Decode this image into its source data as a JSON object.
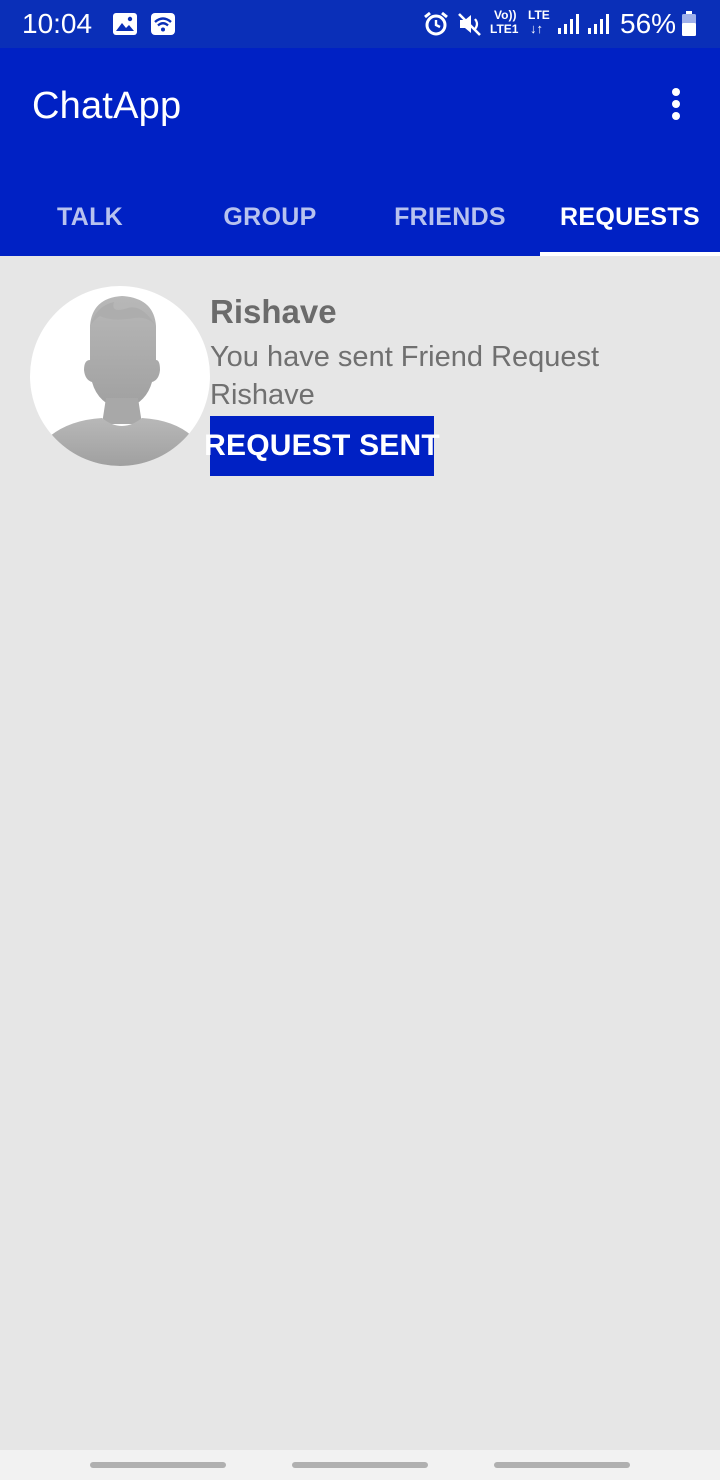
{
  "status_bar": {
    "time": "10:04",
    "battery_percent": "56%",
    "network_lte_top": "Vo))",
    "network_lte_bottom": "LTE1",
    "network_lte2_top": "LTE",
    "network_lte2_bottom": "↓↑",
    "icons": [
      "image-icon",
      "wifi-icon",
      "alarm-icon",
      "mute-icon",
      "signal-icon",
      "signal-icon",
      "battery-icon"
    ]
  },
  "app_bar": {
    "title": "ChatApp",
    "menu_icon": "overflow-menu-icon"
  },
  "tabs": [
    {
      "label": "TALK",
      "active": false
    },
    {
      "label": "GROUP",
      "active": false
    },
    {
      "label": "FRIENDS",
      "active": false
    },
    {
      "label": "REQUESTS",
      "active": true
    }
  ],
  "requests": [
    {
      "name": "Rishave",
      "message": "You have sent Friend Request Rishave",
      "button_label": "REQUEST SENT",
      "avatar_icon": "default-avatar-icon"
    }
  ],
  "colors": {
    "status_bar": "#0a2fb8",
    "app_bar": "#0021c4",
    "background": "#e6e6e6",
    "button": "#0021c4"
  }
}
